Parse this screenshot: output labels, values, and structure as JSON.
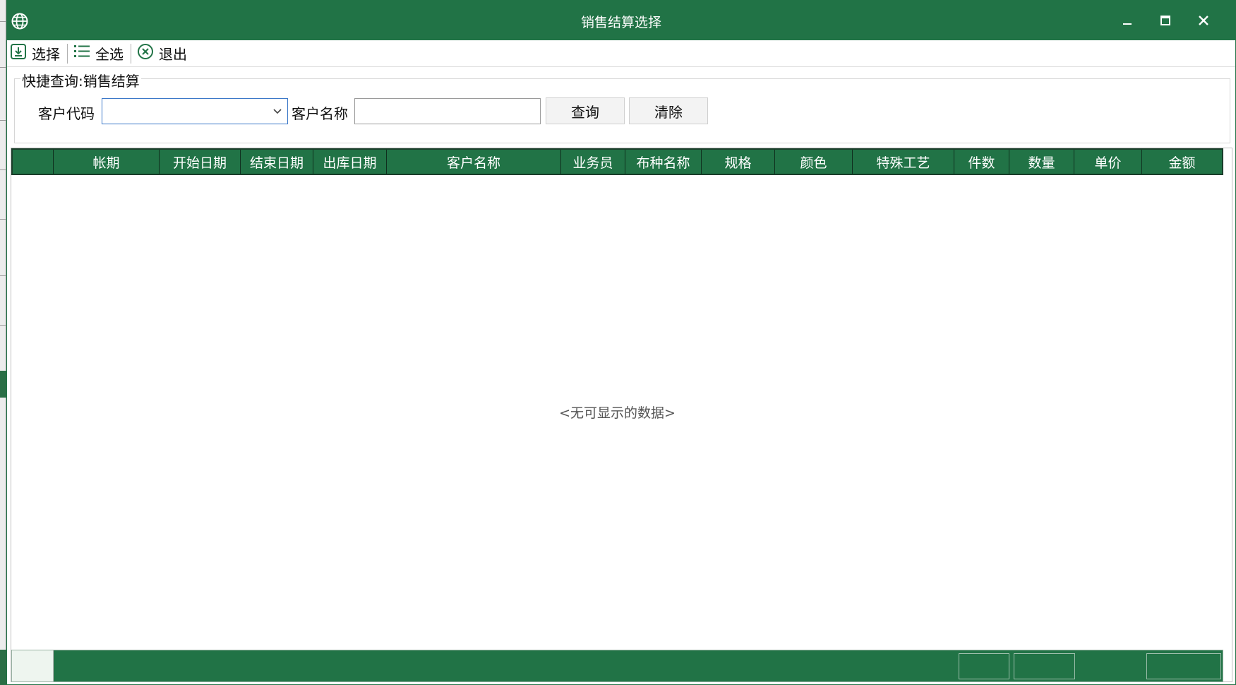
{
  "window": {
    "title": "销售结算选择",
    "controls": {
      "minimize": "–",
      "maximize": "□",
      "close": "✕"
    }
  },
  "toolbar": {
    "select_label": "选择",
    "select_all_label": "全选",
    "exit_label": "退出"
  },
  "quick_search": {
    "title": "快捷查询:销售结算",
    "customer_code_label": "客户代码",
    "customer_code_value": "",
    "customer_name_label": "客户名称",
    "customer_name_value": "",
    "query_button": "查询",
    "clear_button": "清除"
  },
  "grid": {
    "columns": [
      "",
      "帐期",
      "开始日期",
      "结束日期",
      "出库日期",
      "客户名称",
      "业务员",
      "布种名称",
      "规格",
      "颜色",
      "特殊工艺",
      "件数",
      "数量",
      "单价",
      "金额"
    ],
    "rows": [],
    "empty_text": "<无可显示的数据>"
  },
  "colors": {
    "accent": "#217346",
    "header_border": "#1a3d2a",
    "focus_border": "#3b78c8"
  },
  "icons": {
    "app": "globe-icon",
    "select": "download-icon",
    "select_all": "list-icon",
    "exit": "cancel-circle-icon",
    "combo_arrow": "chevron-down-icon"
  }
}
